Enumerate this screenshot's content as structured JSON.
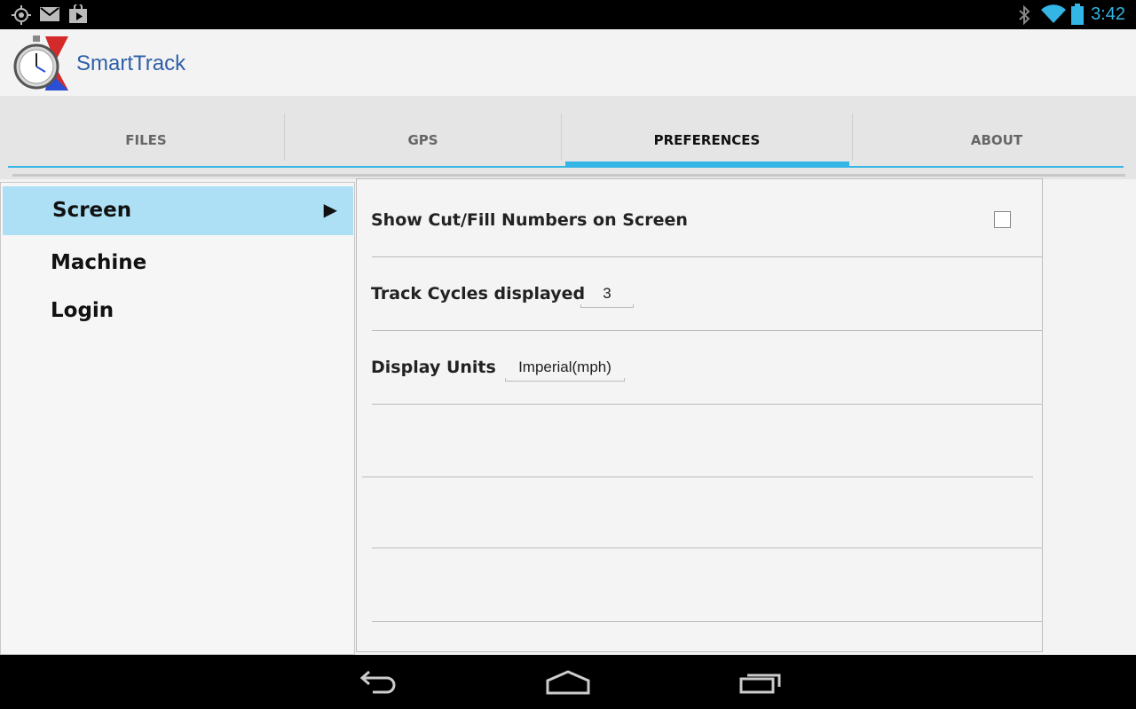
{
  "status_bar": {
    "time": "3:42",
    "icons": [
      "gps-icon",
      "gmail-icon",
      "play-store-icon",
      "bluetooth-icon",
      "wifi-icon",
      "battery-icon"
    ]
  },
  "action_bar": {
    "app_title": "SmartTrack",
    "logo": "stopwatch-logo"
  },
  "tabs": [
    {
      "label": "FILES",
      "active": false
    },
    {
      "label": "GPS",
      "active": false
    },
    {
      "label": "PREFERENCES",
      "active": true
    },
    {
      "label": "ABOUT",
      "active": false
    }
  ],
  "left_nav": {
    "items": [
      {
        "label": "Screen",
        "selected": true
      },
      {
        "label": "Machine",
        "selected": false
      },
      {
        "label": "Login",
        "selected": false
      }
    ]
  },
  "preferences": {
    "show_cut_fill": {
      "label": "Show Cut/Fill Numbers on Screen",
      "checked": false
    },
    "track_cycles": {
      "label": "Track Cycles displayed",
      "value": "3"
    },
    "display_units": {
      "label": "Display Units",
      "value": "Imperial(mph)"
    }
  },
  "colors": {
    "accent": "#33b5e5",
    "selected_bg": "#ade0f5",
    "title": "#2e5fa8"
  },
  "nav_bar": {
    "buttons": [
      "back-icon",
      "home-icon",
      "recent-apps-icon"
    ]
  }
}
